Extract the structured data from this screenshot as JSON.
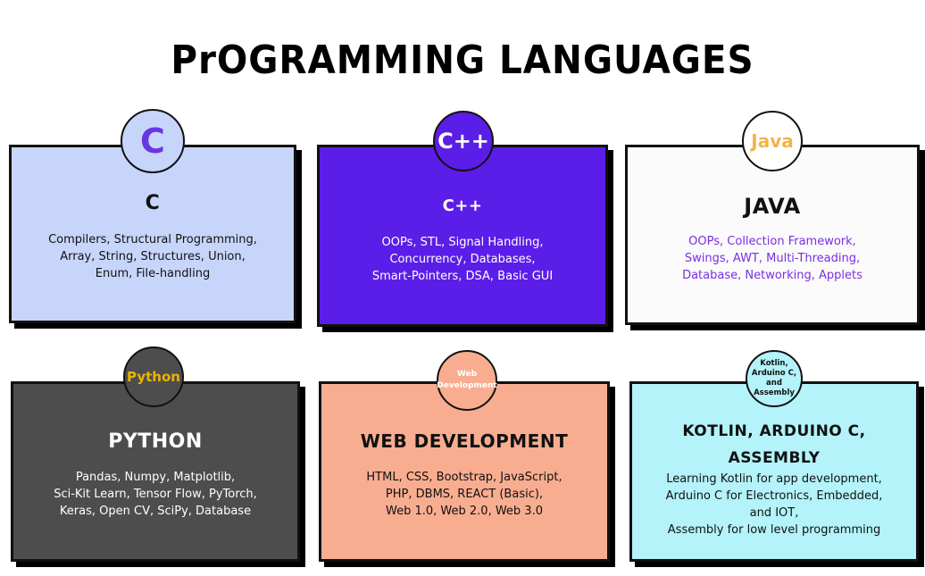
{
  "title": "PrOGRAMMING LANGUAGES",
  "colors": {
    "c_card": "#c8d5fb",
    "cpp_card": "#5b1ee8",
    "java_card": "#fbfbfb",
    "python_card": "#4d4d4d",
    "web_card": "#f8ad90",
    "kotlin_card": "#b3f3f9",
    "c_badge_text": "#6a35e2",
    "java_badge_text": "#f3b34a",
    "python_badge_text": "#e8b400",
    "java_body_text": "#7a2fe3"
  },
  "cards": {
    "c": {
      "badge": "C",
      "heading": "C",
      "lines": [
        "Compilers, Structural Programming,",
        "Array, String, Structures, Union,",
        "Enum, File-handling"
      ]
    },
    "cpp": {
      "badge": "C++",
      "heading": "C++",
      "lines": [
        "OOPs, STL, Signal Handling,",
        "Concurrency, Databases,",
        "Smart-Pointers, DSA, Basic GUI"
      ]
    },
    "java": {
      "badge": "Java",
      "heading": "JAVA",
      "lines": [
        "OOPs, Collection Framework,",
        "Swings, AWT, Multi-Threading,",
        "Database, Networking, Applets"
      ]
    },
    "python": {
      "badge": "Python",
      "heading": "PYTHON",
      "lines": [
        "Pandas, Numpy, Matplotlib,",
        "Sci-Kit Learn, Tensor Flow, PyTorch,",
        "Keras, Open CV, SciPy,  Database"
      ]
    },
    "web": {
      "badge_lines": [
        "Web",
        "Development"
      ],
      "heading": "WEB DEVELOPMENT",
      "lines": [
        "HTML, CSS, Bootstrap, JavaScript,",
        "PHP, DBMS, REACT (Basic),",
        "Web 1.0, Web 2.0, Web 3.0"
      ]
    },
    "kotlin": {
      "badge_lines": [
        "Kotlin,",
        "Arduino C,",
        "and",
        "Assembly"
      ],
      "heading_lines": [
        "KOTLIN, ARDUINO C,",
        "ASSEMBLY"
      ],
      "lines": [
        "Learning Kotlin for app development,",
        "Arduino C for Electronics, Embedded,",
        "and IOT,",
        "Assembly for low level programming"
      ]
    }
  }
}
